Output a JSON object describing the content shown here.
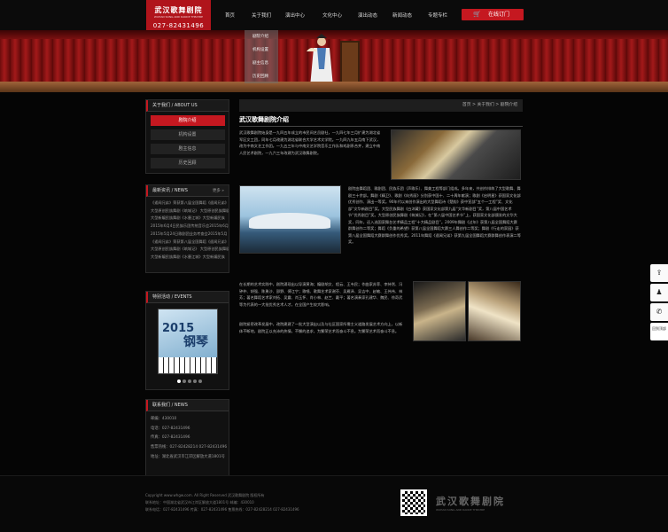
{
  "header": {
    "logo_cn": "武汉歌舞剧院",
    "logo_en": "WUHAN SONG AND DANCE THEATRE",
    "phone": "027-82431496",
    "nav": [
      "首页",
      "关于我们",
      "演出中心",
      "文化中心",
      "演出动态",
      "新闻动态",
      "专题专栏"
    ],
    "order_label": "在线订门",
    "dropdown": [
      "剧院介绍",
      "机构设置",
      "剧主信息",
      "历史回顾"
    ]
  },
  "sidebar": {
    "about_title": "关于我们 / ABOUT US",
    "menu": [
      "剧院介绍",
      "机构设置",
      "剧主信息",
      "历史回顾"
    ],
    "news_title": "最新资讯 / NEWS",
    "more": "更多 »",
    "news": [
      "《遥闻兄弟》荣获第八届全国舞蹈《遥闻兄弟》",
      "大型原创民族舞剧《筑城记》 大型原创民族舞剧",
      "大型新编民族舞剧《水墨江城》大型新编民族",
      "2015年6月4日民族乐团传统音乐会2015年6月",
      "2015年5月24日歌剧团业务考查会2015年5月",
      "《遥闻兄弟》荣获第八届全国舞蹈《遥闻兄弟》",
      "大型原创民族舞剧《筑城记》 大型原创民族舞剧",
      "大型新编民族舞剧《水墨江城》大型新编民族"
    ],
    "events_title": "特别活动 / EVENTS",
    "poster_year": "2015",
    "poster_cn": "钢琴",
    "contact_title": "联系我们 / NEWS",
    "contact": [
      "邮编：430010",
      "电话：027-82431496",
      "传真：027-82431496",
      "售票热线：027-82428214 027-82431496",
      "地址：湖北省武汉市江岸区解放大道1801号"
    ]
  },
  "main": {
    "breadcrumb": "首页 > 关于我们 > 剧院介绍",
    "title": "武汉歌舞剧院介绍",
    "p1": "武汉歌舞剧院始身是一九四五年成立的市民间艺员剧社，一九四七年三月扩建为湖北省军区文工团，同年七月改建为湖北省联合大学艺术文学院。一九四九年五月南下武汉，改为中南文艺工作团。一九五三年与中南文艺学院音乐工作队和戏剧系合并，建立中南人民艺术剧院，一九六三年改建为武汉歌舞剧院。",
    "p2": "剧院由舞蹈团、歌剧团、民族乐团（声歌乐）、舞美工程等部门组成。多年来，共创作排练了大型歌舞、舞剧三十余部。舞剧《精卫》、歌剧《向秀丽》分别获中国十、二十周年献演；歌剧《启明星》获国家文化部优秀创作、演出一等奖。90年代以来创作演出的大型舞蹈诗《楚韵》获中宣部“五个一工程”奖、文化部“文华新剧目”奖。大型民族舞剧《白沐藏》获国家文化部第九届“文华新剧目”奖，第八届中国艺术节“优秀剧目”奖。大型原创民族舞剧《筑城记》，在“第八届中国艺术节”上，获国家文化部颁发的文华大奖，同年，还入选国家舞台艺术精品工程“十大精品剧目”。2009年舞剧《过年》获第八届全国舞蹈大赛群舞创作二等奖；舞蹈《负重的希望》获第八届全国舞蹈大赛三人舞创作二等奖；舞剧《行走的家园》获第八届全国舞蹈大赛群舞创作优秀奖。2011年舞蹈《遥闻兄弟》获第九届全国舞蹈大赛群舞创作表演二等奖。",
    "p3": "在长期的艺术实践中，剧院涌现出以导演黄海；编剧胡文、程云、王韦民；作曲家苏菲、李持然、冯钟仲、胡强、陈勇沙、邵野、傅江宁；歌唱、歌舞艺术家谢芬、吴雁泽、吴吉中、赵敏、王伟伟、林芳；著名舞蹈艺术家刘拓、吴震、肖玉怀、肖小林、赵兰、戴平；著名演奏家孔建华、魏民、徐奇武等为代表的一大批优秀艺术人才，在全国产生较大影响。",
    "p4": "剧院紧密改革发展中，改院建建了一批大型演出以及与社区国家所需主义道路发展艺术方向上，以新体不断地，剧院正以充沛的热情，不懈的追求，为繁荣艺术而奋斗不息。为繁荣艺术而奋斗不息。"
  },
  "footer": {
    "copyright": "Copyright www.whgw.com. All Right Reserved 武汉歌舞剧院 版权所有",
    "addr": "联系地址：中国湖北省武汉市江岸区解放大道1801号 邮编：430010",
    "phone": "联系电话：027-82431496 传真：027-82431496 售票热线：027-82428214 027-82431496",
    "logo_cn": "武汉歌舞剧院",
    "logo_en": "WUHAN SONG AND DANCE THEATRE"
  },
  "floatbar": {
    "top": "回到顶部"
  }
}
